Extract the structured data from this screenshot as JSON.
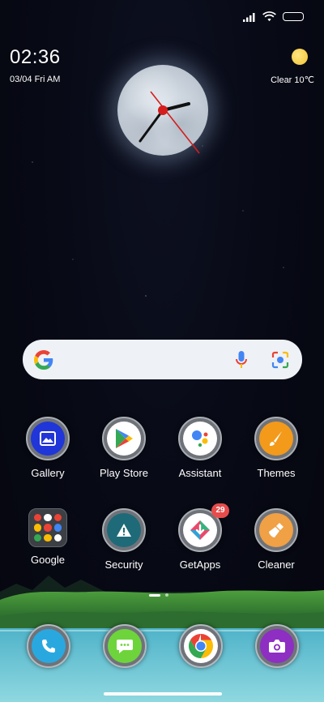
{
  "status_bar": {
    "signal_icon": "signal-icon",
    "wifi_icon": "wifi-icon",
    "battery_icon": "battery-icon"
  },
  "clock": {
    "time": "02:36",
    "date": "03/04 Fri AM"
  },
  "weather": {
    "icon": "sun-icon",
    "text": "Clear 10℃"
  },
  "search_bar": {
    "logo": "G",
    "mic_icon": "mic-icon",
    "lens_icon": "lens-icon"
  },
  "apps": [
    {
      "label": "Gallery",
      "icon": "gallery-icon"
    },
    {
      "label": "Play Store",
      "icon": "play-store-icon"
    },
    {
      "label": "Assistant",
      "icon": "assistant-icon"
    },
    {
      "label": "Themes",
      "icon": "themes-icon"
    },
    {
      "label": "Google",
      "icon": "google-folder-icon"
    },
    {
      "label": "Security",
      "icon": "security-icon"
    },
    {
      "label": "GetApps",
      "icon": "getapps-icon",
      "badge": "29"
    },
    {
      "label": "Cleaner",
      "icon": "cleaner-icon"
    }
  ],
  "dock": [
    {
      "icon": "phone-icon"
    },
    {
      "icon": "messages-icon"
    },
    {
      "icon": "chrome-icon"
    },
    {
      "icon": "camera-icon"
    }
  ],
  "colors": {
    "accent_blue": "#1a73e8",
    "badge_red": "#e74c4c",
    "icon_ring": "#6f7379"
  }
}
